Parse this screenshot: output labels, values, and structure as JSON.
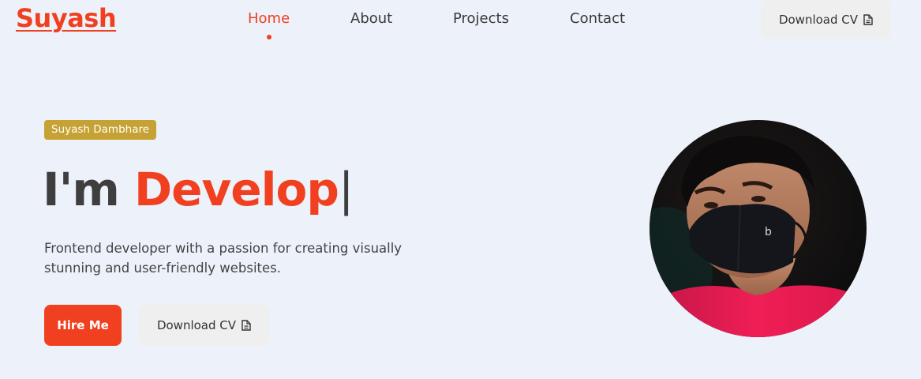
{
  "nav": {
    "logo": "Suyash",
    "links": [
      {
        "label": "Home",
        "active": true
      },
      {
        "label": "About",
        "active": false
      },
      {
        "label": "Projects",
        "active": false
      },
      {
        "label": "Contact",
        "active": false
      }
    ],
    "download_cv": "Download CV",
    "download_icon": "document-icon"
  },
  "hero": {
    "badge": "Suyash Dambhare",
    "headline_prefix": "I'm ",
    "headline_typed": "Develop",
    "cursor": "|",
    "description": "Frontend developer with a passion for creating visually stunning and user-friendly websites.",
    "hire_button": "Hire Me",
    "download_button": "Download CV",
    "download_icon": "document-icon",
    "avatar": "profile-photo"
  },
  "colors": {
    "accent": "#f0401f",
    "badge": "#c5a233",
    "background": "#edf1fa",
    "button_gray": "#efefef"
  }
}
